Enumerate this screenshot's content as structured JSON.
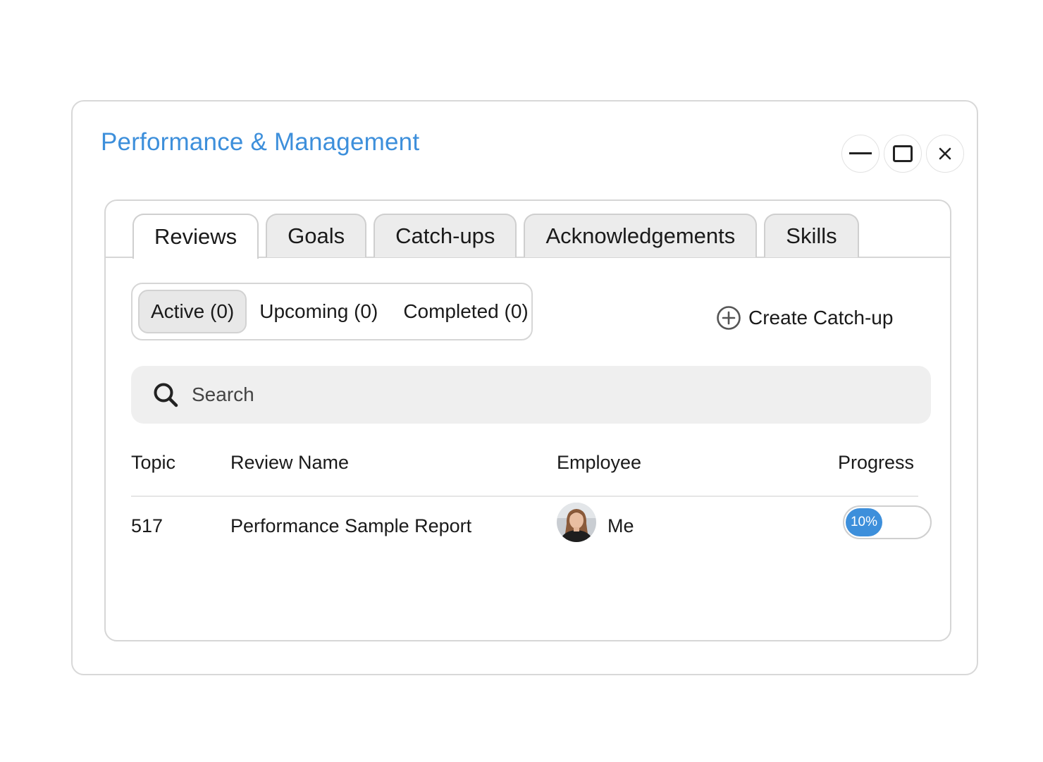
{
  "window": {
    "title": "Performance & Management",
    "controls": [
      "minimize-icon",
      "maximize-icon",
      "close-icon"
    ]
  },
  "tabs": [
    {
      "label": "Reviews",
      "active": true
    },
    {
      "label": "Goals",
      "active": false
    },
    {
      "label": "Catch-ups",
      "active": false
    },
    {
      "label": "Acknowledgements",
      "active": false
    },
    {
      "label": "Skills",
      "active": false
    }
  ],
  "filters": [
    {
      "label": "Active (0)",
      "active": true
    },
    {
      "label": "Upcoming (0)",
      "active": false
    },
    {
      "label": "Completed (0)",
      "active": false
    }
  ],
  "create_button": {
    "label": "Create Catch-up",
    "icon": "plus-circle-icon"
  },
  "search": {
    "placeholder": "Search",
    "icon": "search-icon"
  },
  "table": {
    "headers": {
      "topic": "Topic",
      "review_name": "Review Name",
      "employee": "Employee",
      "progress": "Progress"
    },
    "rows": [
      {
        "topic": "517",
        "review_name": "Performance Sample Report",
        "employee": "Me",
        "progress_label": "10%",
        "progress": 0.1
      }
    ]
  },
  "colors": {
    "accent": "#3d8fdb",
    "tab_inactive": "#ececec",
    "search_bg": "#efefef"
  }
}
